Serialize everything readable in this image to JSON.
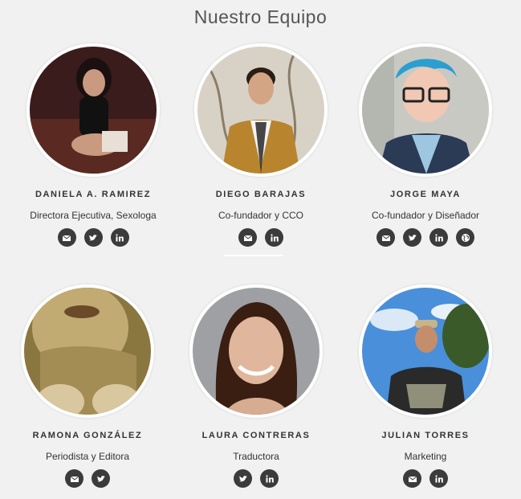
{
  "section_title": "Nuestro Equipo",
  "team": [
    {
      "name": "DANIELA A. RAMIREZ",
      "role": "Directora Ejecutiva, Sexologa",
      "socials": [
        "email-icon",
        "twitter-icon",
        "linkedin-icon"
      ]
    },
    {
      "name": "DIEGO BARAJAS",
      "role": "Co-fundador y CCO",
      "socials": [
        "email-icon",
        "linkedin-icon"
      ]
    },
    {
      "name": "JORGE MAYA",
      "role": "Co-fundador y Diseñador",
      "socials": [
        "email-icon",
        "twitter-icon",
        "linkedin-icon",
        "globe-icon"
      ]
    },
    {
      "name": "RAMONA GONZÁLEZ",
      "role": "Periodista y Editora",
      "socials": [
        "email-icon",
        "twitter-icon"
      ]
    },
    {
      "name": "LAURA CONTRERAS",
      "role": "Traductora",
      "socials": [
        "twitter-icon",
        "linkedin-icon"
      ]
    },
    {
      "name": "JULIAN TORRES",
      "role": "Marketing",
      "socials": [
        "email-icon",
        "linkedin-icon"
      ]
    }
  ],
  "colors": {
    "background": "#f1f1f1",
    "icon_bg": "#3b3b3b",
    "photo_border": "#ffffff"
  }
}
